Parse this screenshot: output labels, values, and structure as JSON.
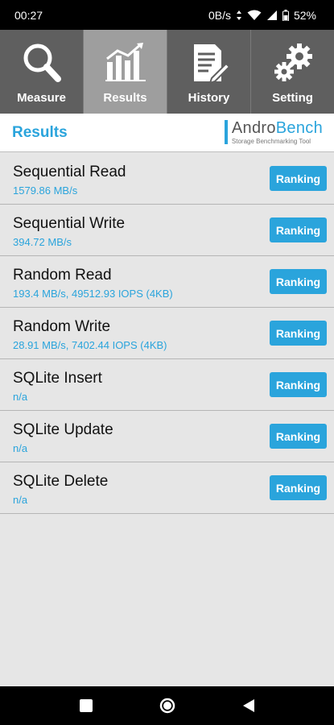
{
  "status_bar": {
    "time": "00:27",
    "net_speed": "0B/s",
    "battery": "52%"
  },
  "tabs": [
    {
      "label": "Measure",
      "icon": "magnifier-icon",
      "active": false
    },
    {
      "label": "Results",
      "icon": "bar-chart-icon",
      "active": true
    },
    {
      "label": "History",
      "icon": "document-pencil-icon",
      "active": false
    },
    {
      "label": "Setting",
      "icon": "gears-icon",
      "active": false
    }
  ],
  "header": {
    "title": "Results",
    "logo_part1": "Andro",
    "logo_part2": "Bench",
    "logo_sub": "Storage Benchmarking Tool"
  },
  "results": [
    {
      "title": "Sequential Read",
      "value": "1579.86 MB/s",
      "button": "Ranking"
    },
    {
      "title": "Sequential Write",
      "value": "394.72 MB/s",
      "button": "Ranking"
    },
    {
      "title": "Random Read",
      "value": "193.4 MB/s, 49512.93 IOPS (4KB)",
      "button": "Ranking"
    },
    {
      "title": "Random Write",
      "value": "28.91 MB/s, 7402.44 IOPS (4KB)",
      "button": "Ranking"
    },
    {
      "title": "SQLite Insert",
      "value": "n/a",
      "button": "Ranking"
    },
    {
      "title": "SQLite Update",
      "value": "n/a",
      "button": "Ranking"
    },
    {
      "title": "SQLite Delete",
      "value": "n/a",
      "button": "Ranking"
    }
  ],
  "colors": {
    "accent": "#2aa4dc",
    "tab_bg": "#5f5f5f",
    "tab_active_bg": "#9e9e9e",
    "list_bg": "#e6e6e6"
  },
  "nav": [
    "recents-square-icon",
    "home-circle-icon",
    "back-triangle-icon"
  ]
}
